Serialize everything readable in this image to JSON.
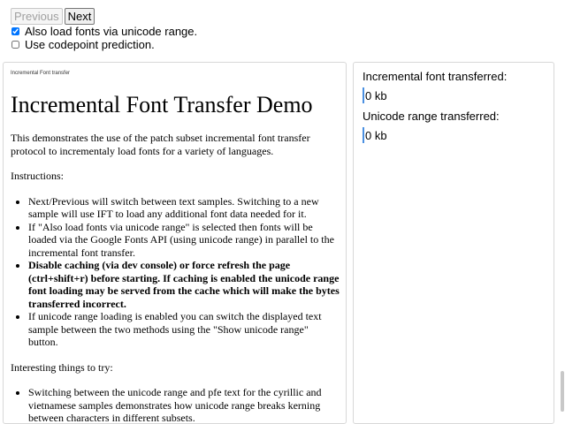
{
  "controls": {
    "previous_label": "Previous",
    "next_label": "Next",
    "unicode_range_label": "Also load fonts via unicode range.",
    "unicode_range_checked": true,
    "codepoint_prediction_label": "Use codepoint prediction.",
    "codepoint_prediction_checked": false
  },
  "sample": {
    "tiny_title": "Incremental Font transfer",
    "heading": "Incremental Font Transfer Demo",
    "intro": "This demonstrates the use of the patch subset incremental font transfer protocol to incrementaly load fonts for a variety of languages.",
    "instructions_heading": "Instructions:",
    "instructions": [
      "Next/Previous will switch between text samples. Switching to a new sample will use IFT to load any additional font data needed for it.",
      "If \"Also load fonts via unicode range\" is selected then fonts will be loaded via the Google Fonts API (using unicode range) in parallel to the incremental font transfer.",
      "Disable caching (via dev console) or force refresh the page (ctrl+shift+r) before starting. If caching is enabled the unicode range font loading may be served from the cache which will make the bytes transferred incorrect.",
      "If unicode range loading is enabled you can switch the displayed text sample between the two methods using the \"Show unicode range\" button."
    ],
    "try_heading": "Interesting things to try:",
    "try_items": [
      "Switching between the unicode range and pfe text for the cyrillic and vietnamese samples demonstrates how unicode range breaks kerning between characters in different subsets."
    ]
  },
  "stats": {
    "ift_label": "Incremental font transferred:",
    "ift_value": "0 kb",
    "unicode_label": "Unicode range transferred:",
    "unicode_value": "0 kb"
  },
  "colors": {
    "stat_bar": "#4a90e2"
  }
}
